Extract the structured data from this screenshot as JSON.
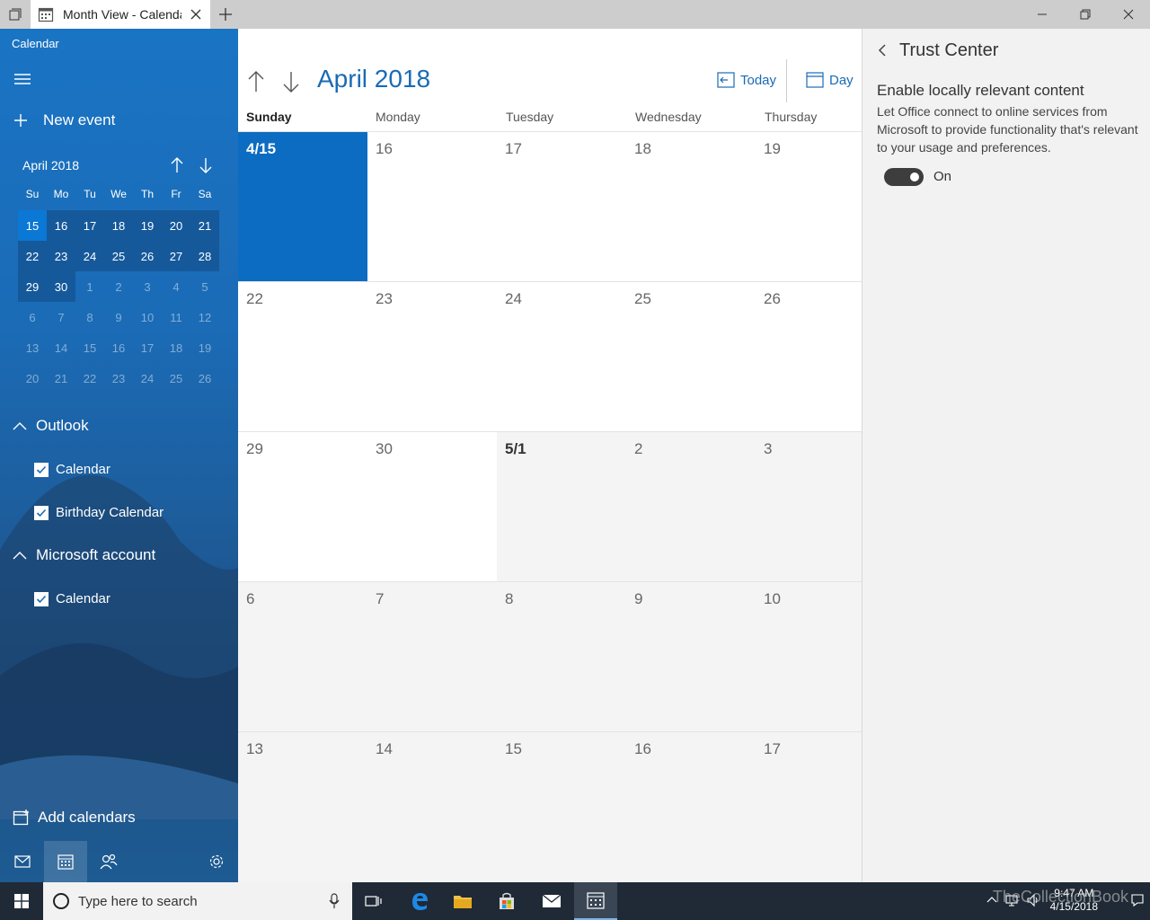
{
  "window": {
    "tab_title": "Month View - Calendar"
  },
  "sidebar": {
    "app_name": "Calendar",
    "new_event_label": "New event",
    "mini_month_label": "April 2018",
    "dow": [
      "Su",
      "Mo",
      "Tu",
      "We",
      "Th",
      "Fr",
      "Sa"
    ],
    "weeks": [
      [
        "15",
        "16",
        "17",
        "18",
        "19",
        "20",
        "21"
      ],
      [
        "22",
        "23",
        "24",
        "25",
        "26",
        "27",
        "28"
      ],
      [
        "29",
        "30",
        "1",
        "2",
        "3",
        "4",
        "5"
      ],
      [
        "6",
        "7",
        "8",
        "9",
        "10",
        "11",
        "12"
      ],
      [
        "13",
        "14",
        "15",
        "16",
        "17",
        "18",
        "19"
      ],
      [
        "20",
        "21",
        "22",
        "23",
        "24",
        "25",
        "26"
      ]
    ],
    "groups": [
      {
        "name": "Outlook",
        "calendars": [
          "Calendar",
          "Birthday Calendar"
        ]
      },
      {
        "name": "Microsoft account",
        "calendars": [
          "Calendar"
        ]
      }
    ],
    "add_calendars_label": "Add calendars"
  },
  "main": {
    "month_title": "April 2018",
    "today_label": "Today",
    "day_label": "Day",
    "dow": [
      "Sunday",
      "Monday",
      "Tuesday",
      "Wednesday",
      "Thursday"
    ],
    "weeks": [
      [
        "4/15",
        "16",
        "17",
        "18",
        "19"
      ],
      [
        "22",
        "23",
        "24",
        "25",
        "26"
      ],
      [
        "29",
        "30",
        "5/1",
        "2",
        "3"
      ],
      [
        "6",
        "7",
        "8",
        "9",
        "10"
      ],
      [
        "13",
        "14",
        "15",
        "16",
        "17"
      ]
    ]
  },
  "trust_center": {
    "title": "Trust Center",
    "heading": "Enable locally relevant content",
    "description": "Let Office connect to online services from Microsoft to provide functionality that's relevant to your usage and preferences.",
    "toggle_label": "On",
    "toggle_state": true
  },
  "taskbar": {
    "search_placeholder": "Type here to search",
    "time": "9:47 AM",
    "date": "4/15/2018",
    "watermark": "TheCollectionBook"
  },
  "colors": {
    "accent": "#0c6cc1",
    "link": "#1a6bb5",
    "sidebar": "#1b6bb6",
    "taskbar": "#1f2a36"
  }
}
